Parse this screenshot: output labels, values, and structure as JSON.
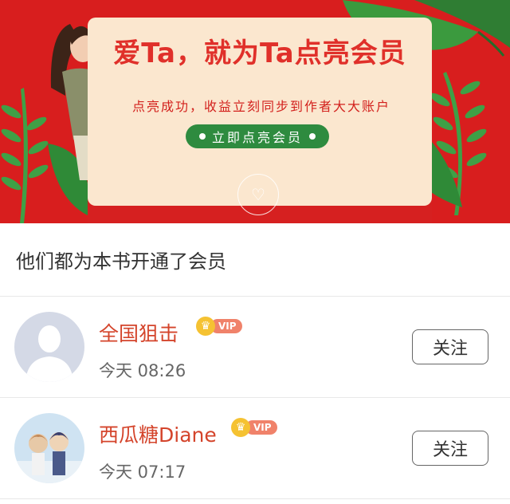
{
  "banner": {
    "headline": "爱Ta，就为Ta点亮会员",
    "subline": "点亮成功，收益立刻同步到作者大大账户",
    "cta_label": "立即点亮会员",
    "colors": {
      "background": "#d81e1e",
      "card": "#fbe7cf",
      "cta": "#2e8b3f",
      "headline": "#e0302a"
    }
  },
  "section_title": "他们都为本书开通了会员",
  "members": [
    {
      "name": "全国狙击",
      "badge": "VIP",
      "time": "今天 08:26",
      "follow_label": "关注",
      "avatar": "default-avatar-icon"
    },
    {
      "name": "西瓜糖Diane",
      "badge": "VIP",
      "time": "今天 07:17",
      "follow_label": "关注",
      "avatar": "anime-avatar"
    }
  ]
}
